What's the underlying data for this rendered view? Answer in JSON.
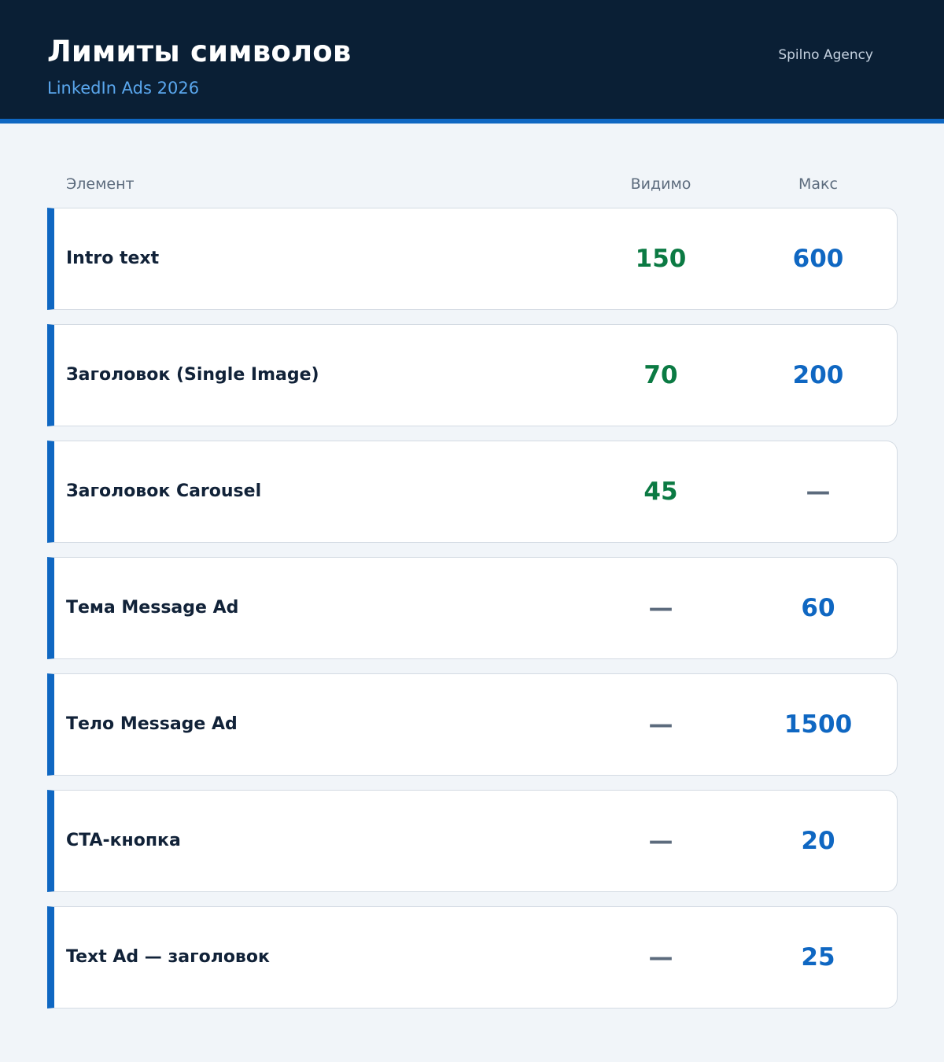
{
  "header": {
    "title": "Лимиты символов",
    "subtitle": "LinkedIn Ads 2026",
    "brand": "Spilno Agency"
  },
  "table": {
    "columns": {
      "element": "Элемент",
      "visible": "Видимо",
      "max": "Макс"
    },
    "rows": [
      {
        "element": "Intro text",
        "visible": "150",
        "max": "600"
      },
      {
        "element": "Заголовок (Single Image)",
        "visible": "70",
        "max": "200"
      },
      {
        "element": "Заголовок Carousel",
        "visible": "45",
        "max": "—"
      },
      {
        "element": "Тема Message Ad",
        "visible": "—",
        "max": "60"
      },
      {
        "element": "Тело Message Ad",
        "visible": "—",
        "max": "1500"
      },
      {
        "element": "CTA-кнопка",
        "visible": "—",
        "max": "20"
      },
      {
        "element": "Text Ad — заголовок",
        "visible": "—",
        "max": "25"
      }
    ]
  },
  "colors": {
    "header_bg": "#0a1f35",
    "accent": "#0f67c2",
    "visible_value": "#0b7a43",
    "max_value": "#0f67c2",
    "empty_value": "#5c6b7d"
  }
}
